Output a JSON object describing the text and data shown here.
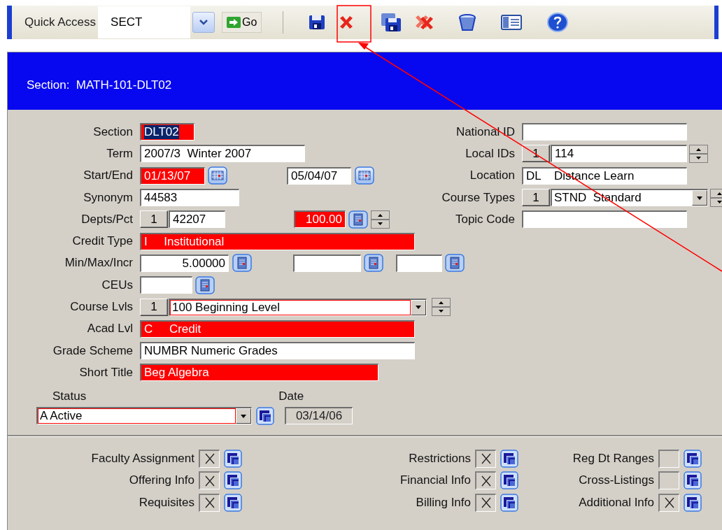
{
  "toolbar": {
    "quick_access_label": "Quick Access",
    "quick_access_value": "SECT",
    "go_label": "Go"
  },
  "header": {
    "title": "Section:  MATH-101-DLT02"
  },
  "left_fields": [
    {
      "label": "Section",
      "parts": [
        {
          "kind": "field",
          "value": "DLT02",
          "required": true,
          "selected": true
        }
      ]
    },
    {
      "label": "Term",
      "parts": [
        {
          "kind": "field",
          "value": "2007/3  Winter 2007",
          "required": false,
          "selected": false
        }
      ]
    },
    {
      "label": "Start/End",
      "parts": [
        {
          "kind": "field",
          "value": "01/13/07",
          "required": true,
          "selected": false
        },
        {
          "kind": "calendar-button"
        },
        {
          "kind": "field",
          "value": "05/04/07",
          "required": false,
          "selected": false
        },
        {
          "kind": "calendar-button"
        }
      ]
    },
    {
      "label": "Synonym",
      "parts": [
        {
          "kind": "field",
          "value": "44583",
          "required": false,
          "selected": false
        }
      ]
    },
    {
      "label": "Depts/Pct",
      "parts": [
        {
          "kind": "counter",
          "value": "1"
        },
        {
          "kind": "field",
          "value": "42207",
          "required": false,
          "selected": false
        },
        {
          "kind": "number-field",
          "value": "100.00",
          "required": true
        },
        {
          "kind": "lookup-button"
        },
        {
          "kind": "spinner"
        }
      ]
    },
    {
      "label": "Credit Type",
      "parts": [
        {
          "kind": "field",
          "value": "I     Institutional",
          "required": true,
          "selected": false
        }
      ]
    },
    {
      "label": "Min/Max/Incr",
      "parts": [
        {
          "kind": "number-field",
          "value": "5.00000",
          "required": false
        },
        {
          "kind": "lookup-button"
        },
        {
          "kind": "number-field",
          "required": false
        },
        {
          "kind": "lookup-button"
        },
        {
          "kind": "number-field",
          "required": false
        },
        {
          "kind": "lookup-button"
        }
      ]
    },
    {
      "label": "CEUs",
      "parts": [
        {
          "kind": "field",
          "required": false,
          "selected": false
        },
        {
          "kind": "lookup-button"
        }
      ]
    },
    {
      "label": "Course Lvls",
      "parts": [
        {
          "kind": "counter",
          "value": "1"
        },
        {
          "kind": "dropdown",
          "value": "100 Beginning Level",
          "required": true
        },
        {
          "kind": "spinner"
        }
      ]
    },
    {
      "label": "Acad Lvl",
      "parts": [
        {
          "kind": "field",
          "value": "C     Credit",
          "required": true,
          "selected": false
        }
      ]
    },
    {
      "label": "Grade Scheme",
      "parts": [
        {
          "kind": "field",
          "value": "NUMBR Numeric Grades",
          "required": false,
          "selected": false
        }
      ]
    },
    {
      "label": "Short Title",
      "parts": [
        {
          "kind": "field",
          "value": "Beg Algebra",
          "required": true,
          "selected": false
        }
      ]
    }
  ],
  "right_fields": [
    {
      "label": "National ID",
      "parts": [
        {
          "kind": "field",
          "required": false,
          "selected": false
        }
      ]
    },
    {
      "label": "Local IDs",
      "parts": [
        {
          "kind": "counter",
          "value": "1"
        },
        {
          "kind": "field",
          "value": "114",
          "required": false,
          "selected": false
        },
        {
          "kind": "spinner"
        }
      ]
    },
    {
      "label": "Location",
      "parts": [
        {
          "kind": "field",
          "value": "DL    Distance Learn",
          "required": false,
          "selected": false
        }
      ]
    },
    {
      "label": "Course Types",
      "parts": [
        {
          "kind": "counter",
          "value": "1"
        },
        {
          "kind": "dropdown",
          "value": "STND  Standard",
          "required": false
        },
        {
          "kind": "spinner"
        }
      ]
    },
    {
      "label": "Topic Code",
      "parts": [
        {
          "kind": "field",
          "required": false,
          "selected": false
        }
      ]
    }
  ],
  "status_block": {
    "status_label": "Status",
    "status_value": "A Active",
    "status_required": true,
    "date_label": "Date",
    "date_value": "03/14/06"
  },
  "detail_links": [
    {
      "label": "Faculty Assignment",
      "checked": true
    },
    {
      "label": "Restrictions",
      "checked": true
    },
    {
      "label": "Reg Dt Ranges",
      "checked": false
    },
    {
      "label": "Offering Info",
      "checked": true
    },
    {
      "label": "Financial Info",
      "checked": true
    },
    {
      "label": "Cross-Listings",
      "checked": false
    },
    {
      "label": "Requisites",
      "checked": true
    },
    {
      "label": "Billing Info",
      "checked": true
    },
    {
      "label": "Additional Info",
      "checked": true
    }
  ]
}
